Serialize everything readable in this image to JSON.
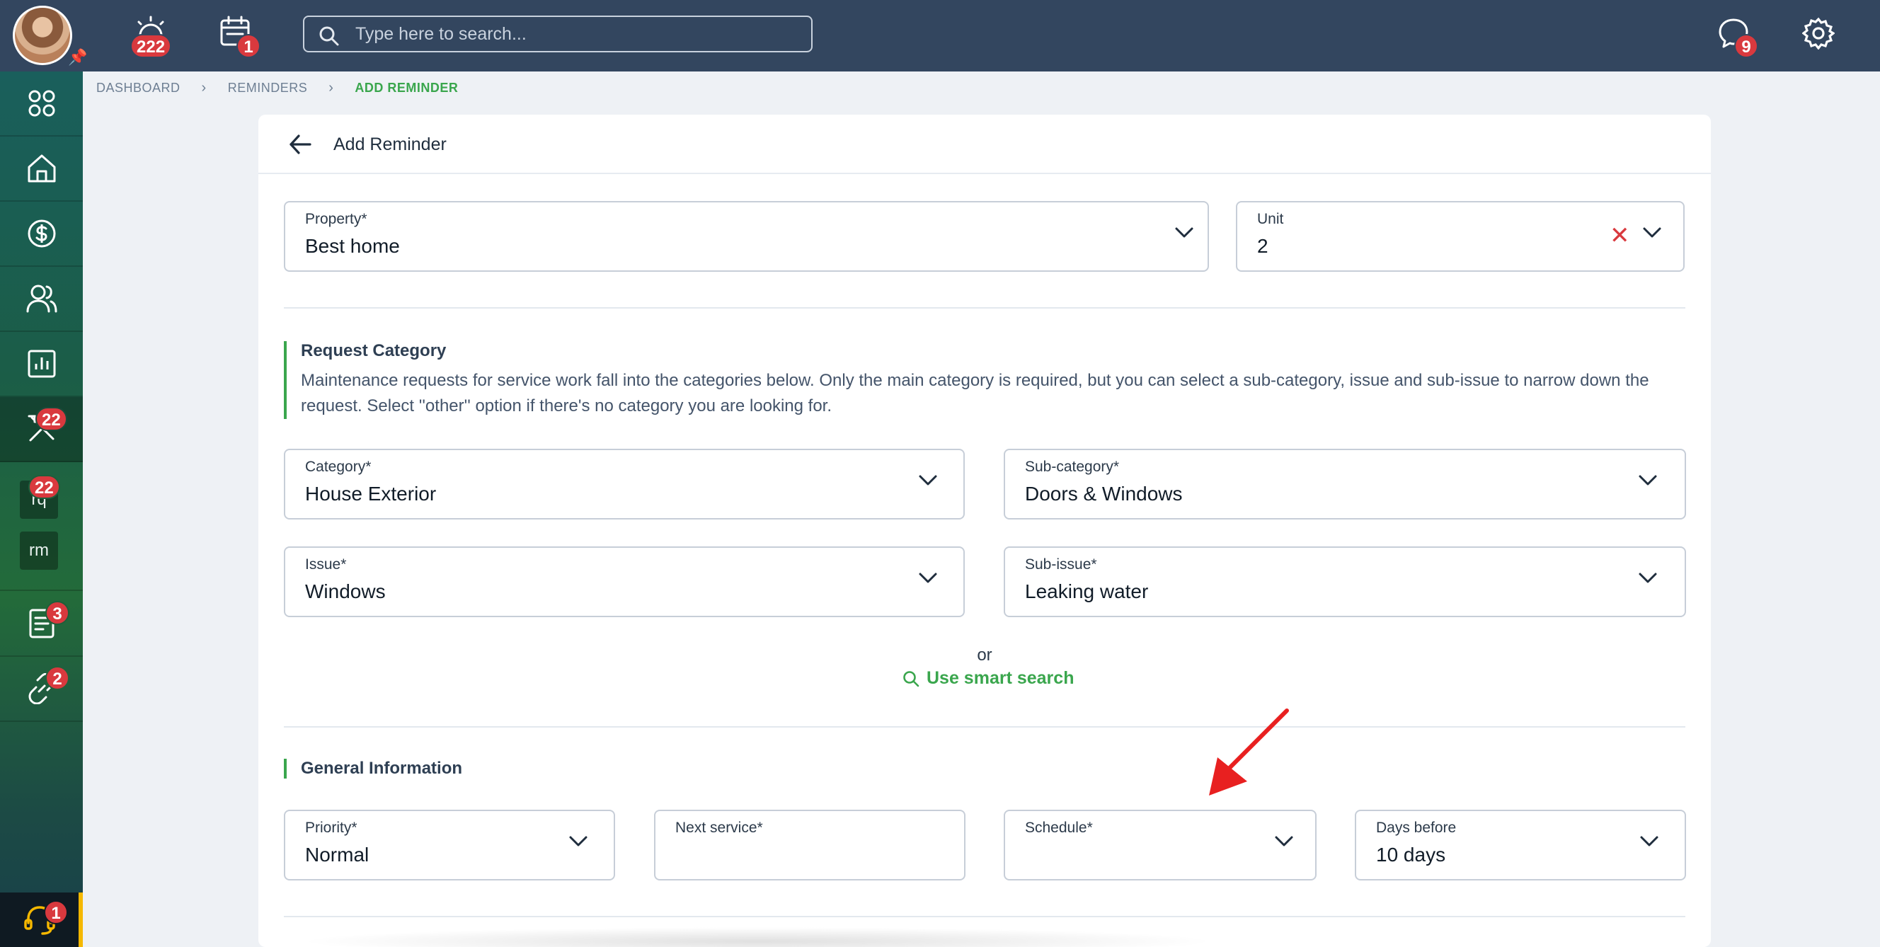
{
  "topbar": {
    "notifications_count": "222",
    "calendar_count": "1",
    "search_placeholder": "Type here to search...",
    "messages_count": "9"
  },
  "sidebar": {
    "maintenance_count": "22",
    "rq_label": "rq",
    "rq_count": "22",
    "rm_label": "rm",
    "documents_count": "3",
    "links_count": "2",
    "support_count": "1"
  },
  "breadcrumb": {
    "items": [
      "DASHBOARD",
      "REMINDERS",
      "ADD REMINDER"
    ]
  },
  "page": {
    "title": "Add Reminder"
  },
  "property": {
    "label": "Property*",
    "value": "Best home"
  },
  "unit": {
    "label": "Unit",
    "value": "2"
  },
  "request_category": {
    "title": "Request Category",
    "description": "Maintenance requests for service work fall into the categories below. Only the main category is required, but you can select a sub-category, issue and sub-issue to narrow down the request. Select ''other'' option if there's no category you are looking for."
  },
  "category": {
    "label": "Category*",
    "value": "House Exterior"
  },
  "subcategory": {
    "label": "Sub-category*",
    "value": "Doors & Windows"
  },
  "issue": {
    "label": "Issue*",
    "value": "Windows"
  },
  "subissue": {
    "label": "Sub-issue*",
    "value": "Leaking water"
  },
  "or_text": "or",
  "smart_search_label": "Use smart search",
  "general_information": {
    "title": "General Information"
  },
  "priority": {
    "label": "Priority*",
    "value": "Normal"
  },
  "next_service": {
    "label": "Next service*",
    "value": ""
  },
  "schedule": {
    "label": "Schedule*",
    "value": ""
  },
  "days_before": {
    "label": "Days before",
    "value": "10 days"
  },
  "colors": {
    "topbar": "#33465f",
    "accent_green": "#3aa64d",
    "badge_red": "#d9393e",
    "annotation_arrow": "#e82020"
  }
}
